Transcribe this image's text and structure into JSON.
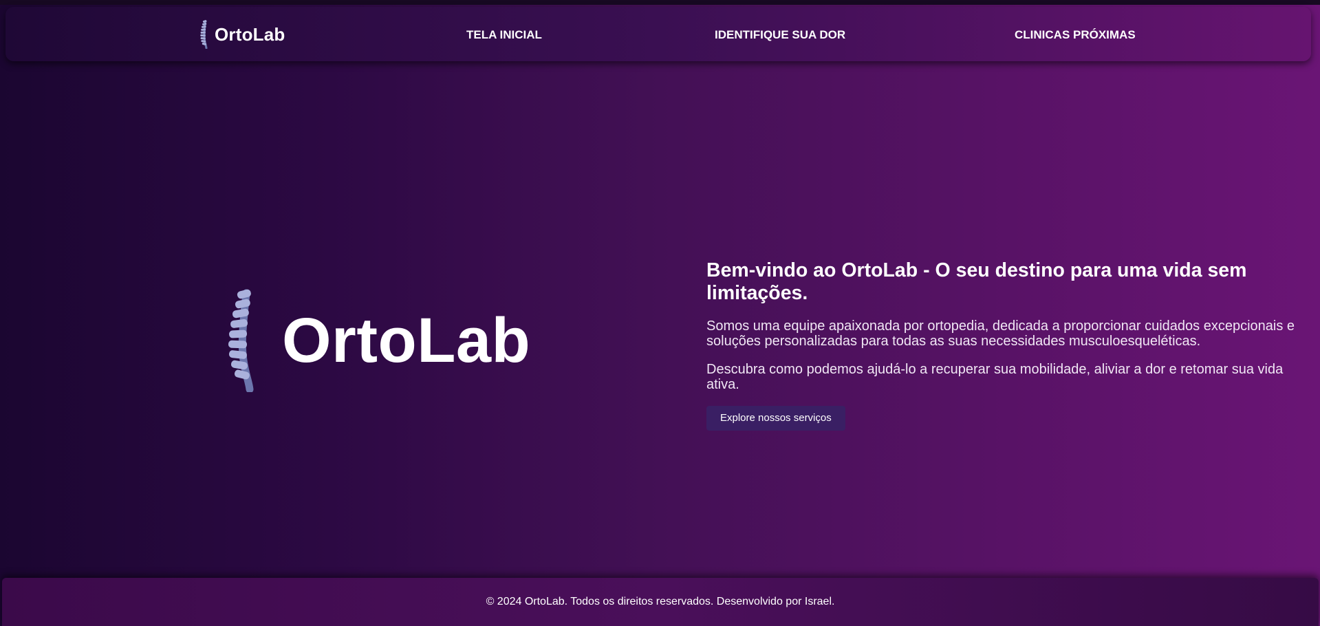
{
  "header": {
    "logo_text": "OrtoLab",
    "nav": [
      {
        "label": "TELA INICIAL"
      },
      {
        "label": "IDENTIFIQUE SUA DOR"
      },
      {
        "label": "CLINICAS PRÓXIMAS"
      }
    ]
  },
  "hero": {
    "logo_text": "OrtoLab",
    "title": "Bem-vindo ao OrtoLab - O seu destino para uma vida sem limitações.",
    "paragraphs": [
      "Somos uma equipe apaixonada por ortopedia, dedicada a proporcionar cuidados excepcionais e soluções personalizadas para todas as suas necessidades musculoesqueléticas.",
      "Descubra como podemos ajudá-lo a recuperar sua mobilidade, aliviar a dor e retomar sua vida ativa."
    ],
    "cta_label": "Explore nossos serviços"
  },
  "footer": {
    "text": "© 2024 OrtoLab. Todos os direitos reservados. Desenvolvido por Israel."
  },
  "icons": {
    "logo": "spine-icon"
  },
  "colors": {
    "background_start": "#1b0631",
    "background_end": "#6a1575",
    "spine": "#a9b0dc",
    "cta_background": "#3a1f64"
  }
}
